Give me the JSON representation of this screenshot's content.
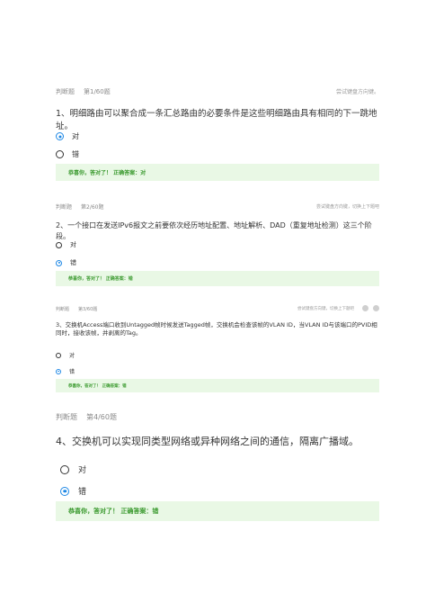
{
  "questions": [
    {
      "type": "判断题",
      "number": "第1/60题",
      "hint": "尝试键盘方向键。",
      "text": "1、明细路由可以聚合成一条汇总路由的必要条件是这些明细路由具有相同的下一跳地址。",
      "options": [
        "对",
        "错"
      ],
      "selected": 0,
      "feedback": "恭喜你，答对了！ 正确答案：对"
    },
    {
      "type": "判断题",
      "number": "第2/60题",
      "hint": "尝试键盘方向键，切换上下题吧",
      "text": "2、一个接口在发送IPv6报文之前要依次经历地址配置、地址解析、DAD（重复地址检测）这三个阶段。",
      "options": [
        "对",
        "错"
      ],
      "selected": 1,
      "feedback": "恭喜你，答对了！ 正确答案：错"
    },
    {
      "type": "判断题",
      "number": "第3/60题",
      "hint": "尝试键盘方向键，切换上下题吧",
      "text": "3、交换机Access端口收到Untagged帧时候发送Tagged帧，交换机会检查该帧的VLAN ID，当VLAN ID与该端口的PVID相同时，接收该帧，并剥离的Tag。",
      "options": [
        "对",
        "错"
      ],
      "selected": 1,
      "feedback": "恭喜你，答对了！ 正确答案：错"
    },
    {
      "type": "判断题",
      "number": "第4/60题",
      "hint": "",
      "text": "4、交换机可以实现同类型网络或异种网络之间的通信，隔离广播域。",
      "options": [
        "对",
        "错"
      ],
      "selected": 1,
      "feedback": "恭喜你，答对了！ 正确答案：错"
    }
  ],
  "colors": {
    "accent": "#1e88e5",
    "feedback_bg": "#e9f8e5",
    "feedback_text": "#3b9a2f"
  }
}
